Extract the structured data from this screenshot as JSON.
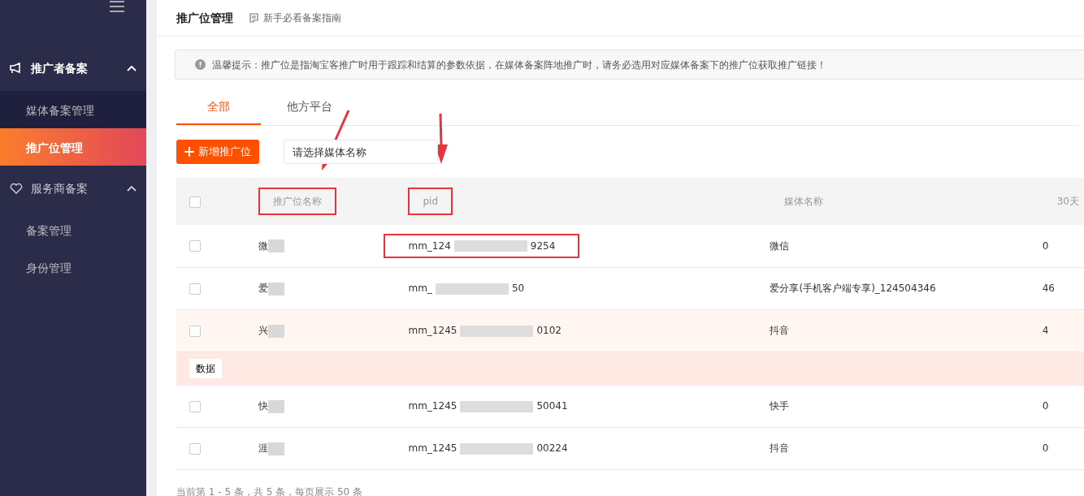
{
  "sidebar": {
    "groups": [
      {
        "label": "推广者备案",
        "kind": "promoter",
        "expanded": true,
        "items": [
          {
            "label": "媒体备案管理",
            "selected": false
          },
          {
            "label": "推广位管理",
            "selected": true
          }
        ]
      },
      {
        "label": "服务商备案",
        "kind": "provider",
        "expanded": true,
        "items": [
          {
            "label": "备案管理",
            "selected": false
          },
          {
            "label": "身份管理",
            "selected": false
          }
        ]
      }
    ]
  },
  "header": {
    "title": "推广位管理",
    "guide_link": "新手必看备案指南"
  },
  "notice": "温馨提示：推广位是指淘宝客推广时用于跟踪和结算的参数依据，在媒体备案阵地推广时，请务必选用对应媒体备案下的推广位获取推广链接！",
  "tabs": [
    {
      "label": "全部",
      "selected": true
    },
    {
      "label": "他方平台",
      "selected": false
    }
  ],
  "add_button": "新增推广位",
  "media_select": {
    "placeholder": "请选择媒体名称"
  },
  "table": {
    "select_all_checked": false,
    "columns": [
      {
        "label": "推广位名称",
        "highlighted": true
      },
      {
        "label": "pid",
        "highlighted": true
      },
      {
        "label": "媒体名称",
        "highlighted": false
      },
      {
        "label": "30天",
        "highlighted": false
      }
    ],
    "rows": [
      {
        "checked": false,
        "selected": false,
        "name": "微",
        "pid": "mm_124",
        "pid_tail": "9254",
        "pid_highlighted": true,
        "media": "微信",
        "count": "0"
      },
      {
        "checked": false,
        "selected": false,
        "name": "爱",
        "pid": "mm_",
        "pid_tail": "50",
        "pid_highlighted": false,
        "media": "爱分享(手机客户端专享)_124504346",
        "count": "46"
      },
      {
        "checked": false,
        "selected": true,
        "name": "兴",
        "pid": "mm_1245",
        "pid_tail": "0102",
        "pid_highlighted": false,
        "media": "抖音",
        "count": "4",
        "detail_button": "数据"
      },
      {
        "checked": false,
        "selected": false,
        "name": "快",
        "pid": "mm_1245",
        "pid_tail": "50041",
        "pid_highlighted": false,
        "media": "快手",
        "count": "0"
      },
      {
        "checked": false,
        "selected": false,
        "name": "涯",
        "pid": "mm_1245",
        "pid_tail": "00224",
        "pid_highlighted": false,
        "media": "抖音",
        "count": "0"
      }
    ]
  },
  "footer": "当前第 1 - 5 条，共 5 条，每页展示 50 条"
}
